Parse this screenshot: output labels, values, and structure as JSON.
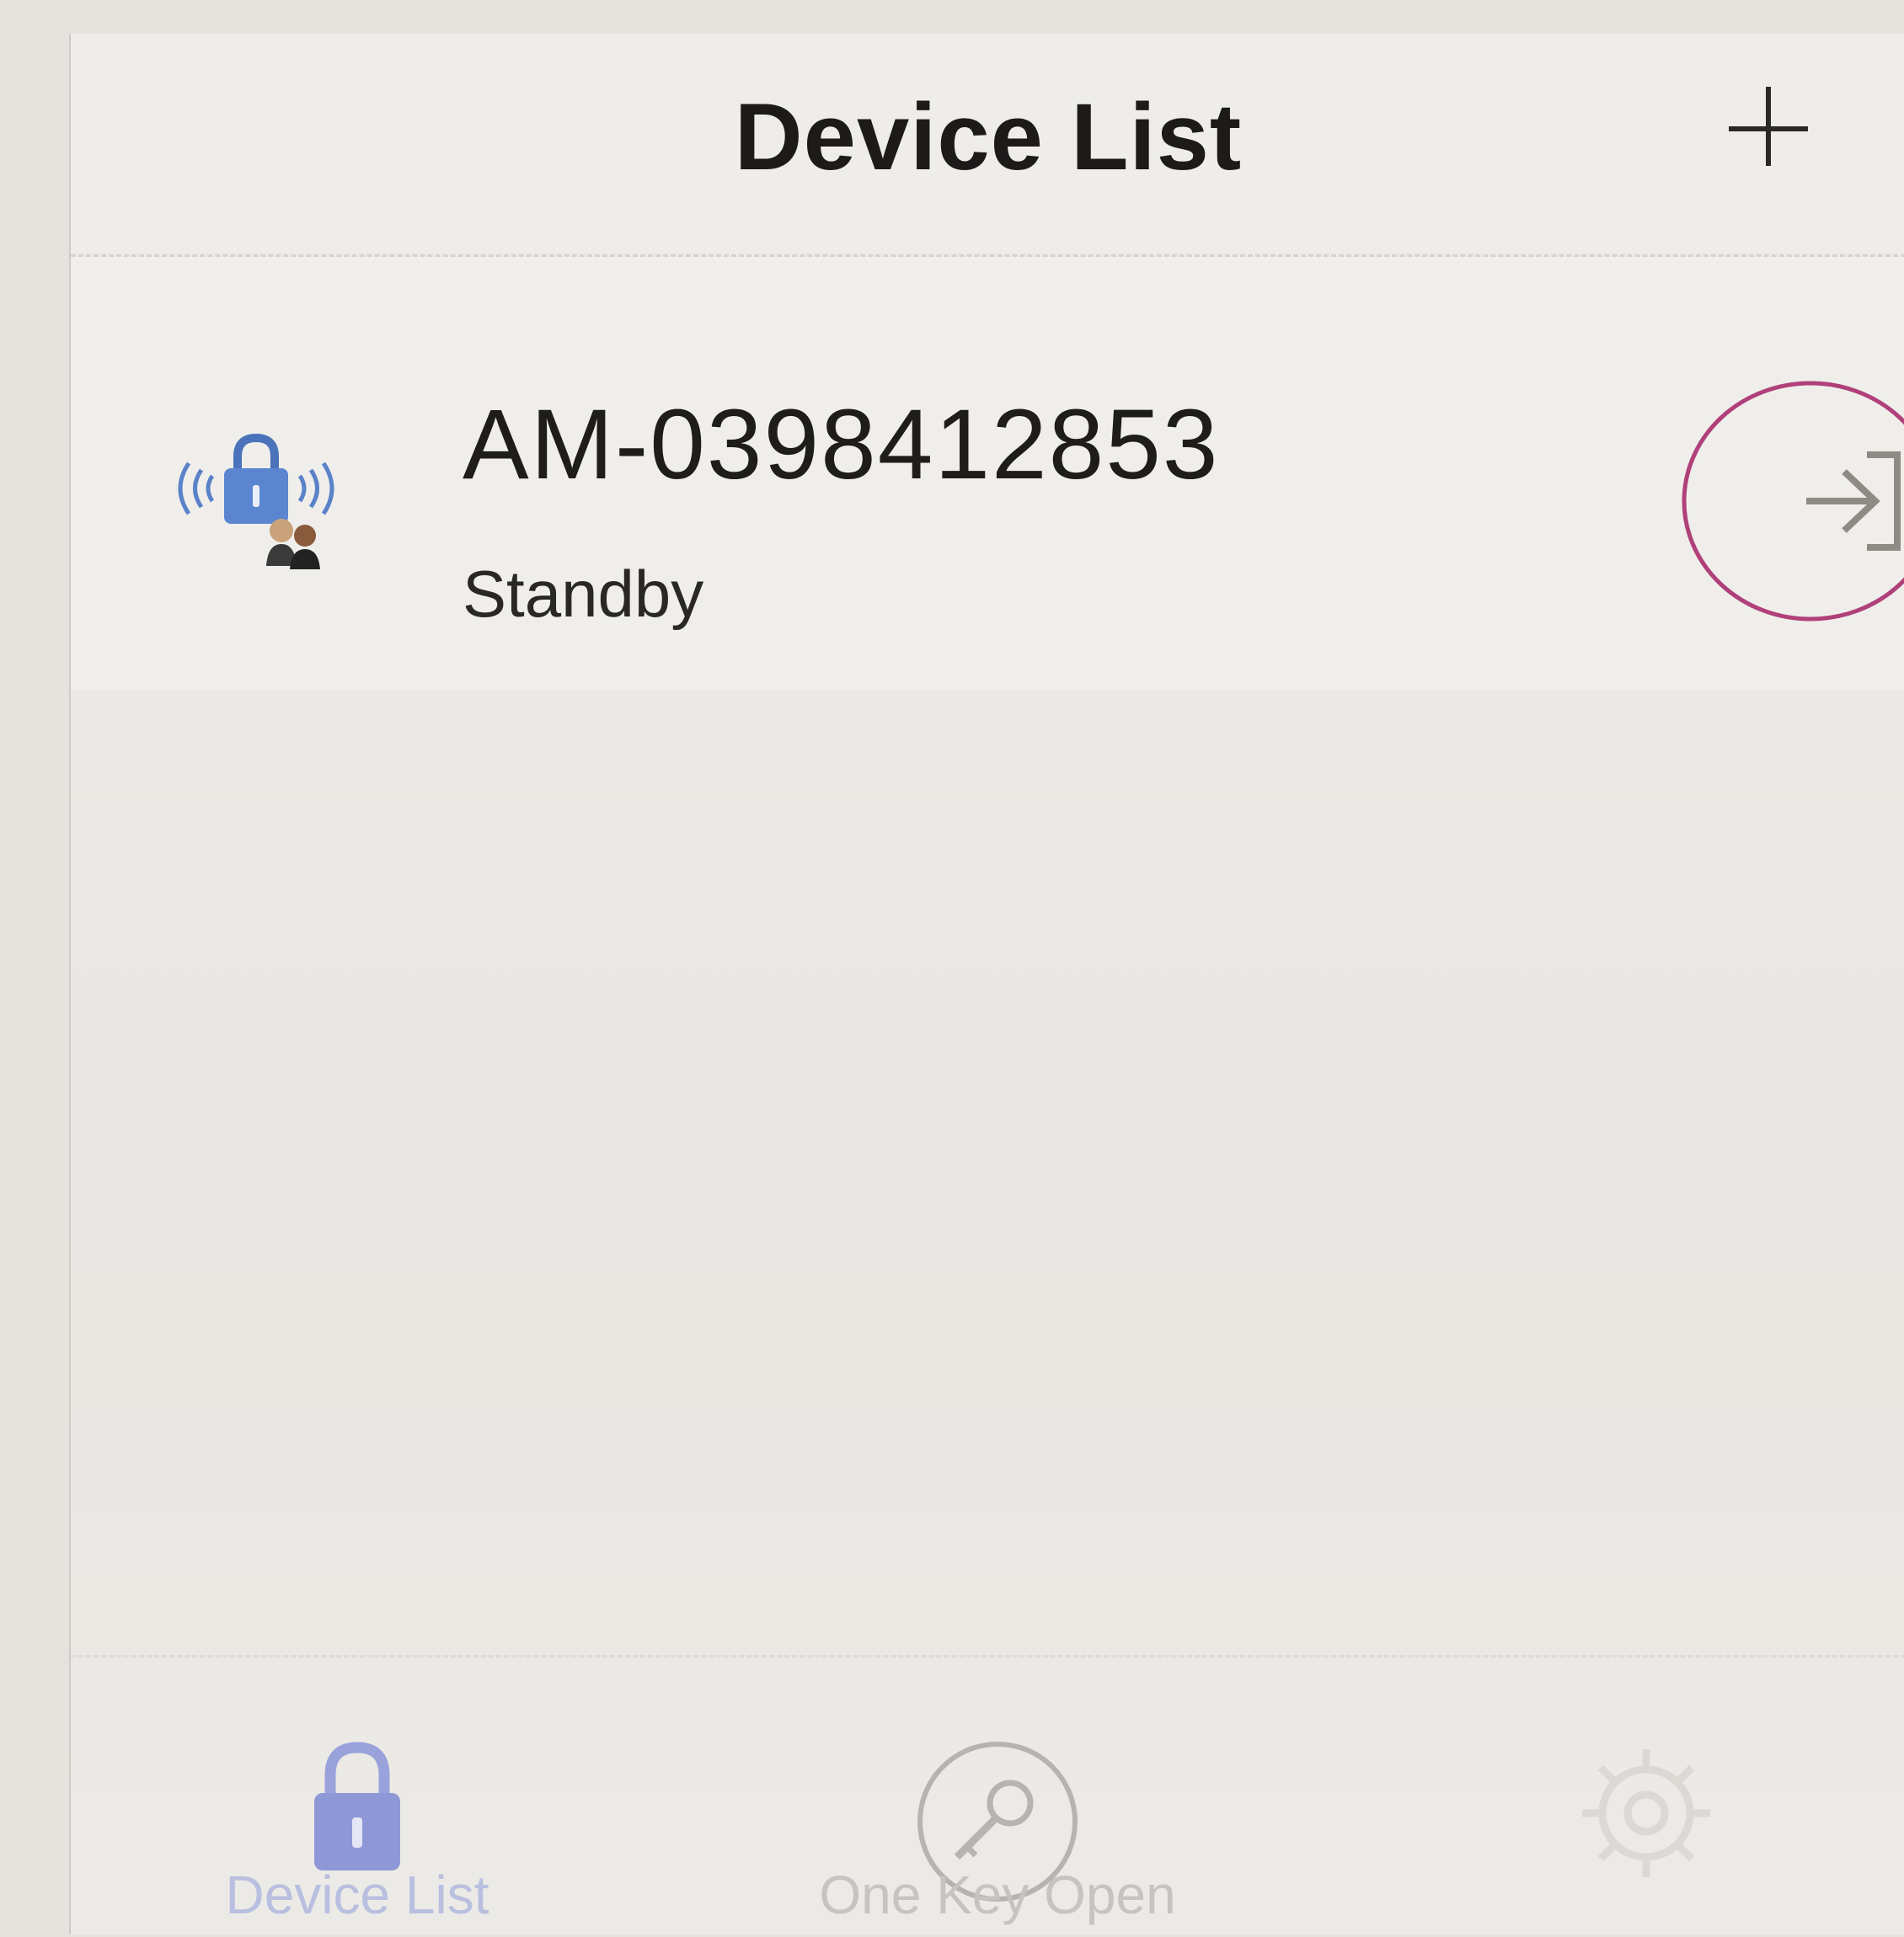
{
  "header": {
    "title": "Device List",
    "add_icon": "plus-icon"
  },
  "devices": [
    {
      "name": "AM-0398412853",
      "status": "Standby",
      "icon": "wireless-lock-icon",
      "action_icon": "enter-icon",
      "action_highlight_color": "#b0407a"
    }
  ],
  "tabbar": {
    "tabs": [
      {
        "label": "Device List",
        "icon": "lock-icon",
        "active": true
      },
      {
        "label": "One Key Open",
        "icon": "key-icon",
        "active": false
      },
      {
        "label": "",
        "icon": "gear-icon",
        "active": false
      }
    ]
  },
  "colors": {
    "accent": "#5b82c9",
    "active_tab": "#8f98d6",
    "inactive_tab": "#b7b4b0"
  }
}
